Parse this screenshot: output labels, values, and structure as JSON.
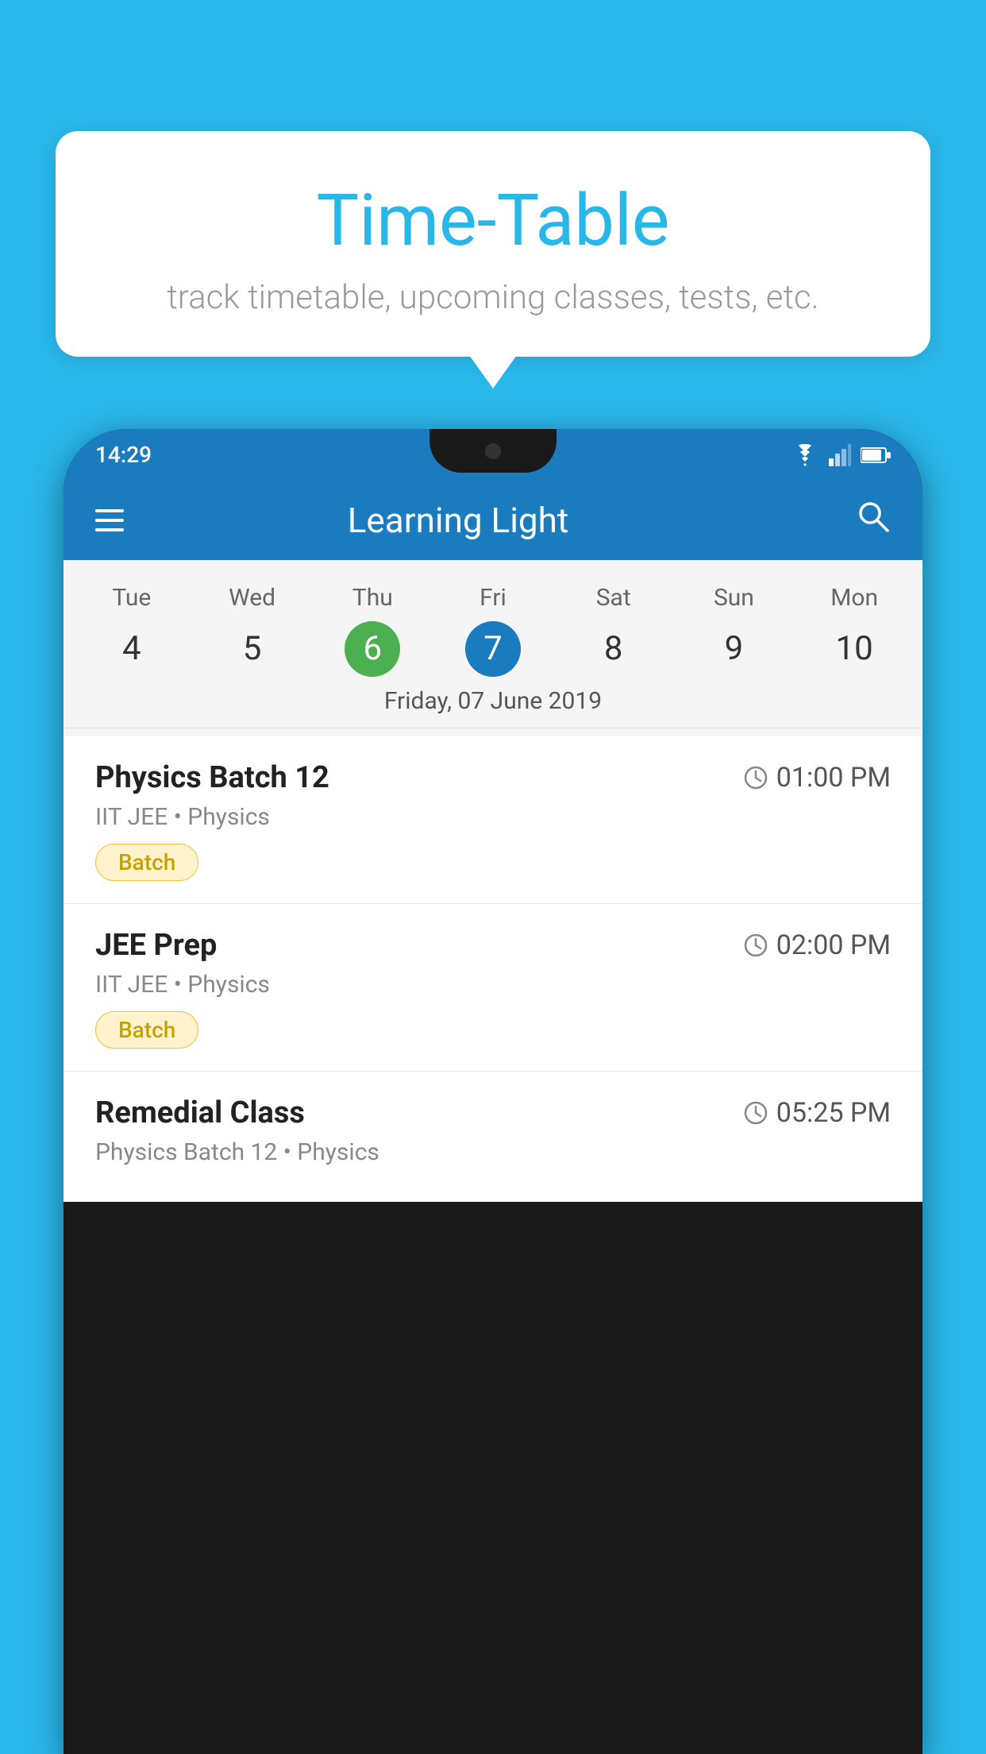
{
  "background_color": "#29B6E8",
  "speech_bubble": {
    "title": "Time-Table",
    "subtitle": "track timetable, upcoming classes, tests, etc."
  },
  "phone": {
    "status_bar": {
      "time": "14:29"
    },
    "app_bar": {
      "title": "Learning Light"
    },
    "calendar": {
      "day_headers": [
        "Tue",
        "Wed",
        "Thu",
        "Fri",
        "Sat",
        "Sun",
        "Mon"
      ],
      "day_numbers": [
        {
          "num": "4",
          "state": "normal"
        },
        {
          "num": "5",
          "state": "normal"
        },
        {
          "num": "6",
          "state": "today"
        },
        {
          "num": "7",
          "state": "selected"
        },
        {
          "num": "8",
          "state": "normal"
        },
        {
          "num": "9",
          "state": "normal"
        },
        {
          "num": "10",
          "state": "normal"
        }
      ],
      "selected_date_label": "Friday, 07 June 2019"
    },
    "schedule": {
      "items": [
        {
          "name": "Physics Batch 12",
          "time": "01:00 PM",
          "subtitle": "IIT JEE • Physics",
          "tag": "Batch"
        },
        {
          "name": "JEE Prep",
          "time": "02:00 PM",
          "subtitle": "IIT JEE • Physics",
          "tag": "Batch"
        },
        {
          "name": "Remedial Class",
          "time": "05:25 PM",
          "subtitle": "Physics Batch 12 • Physics",
          "tag": null
        }
      ]
    }
  }
}
